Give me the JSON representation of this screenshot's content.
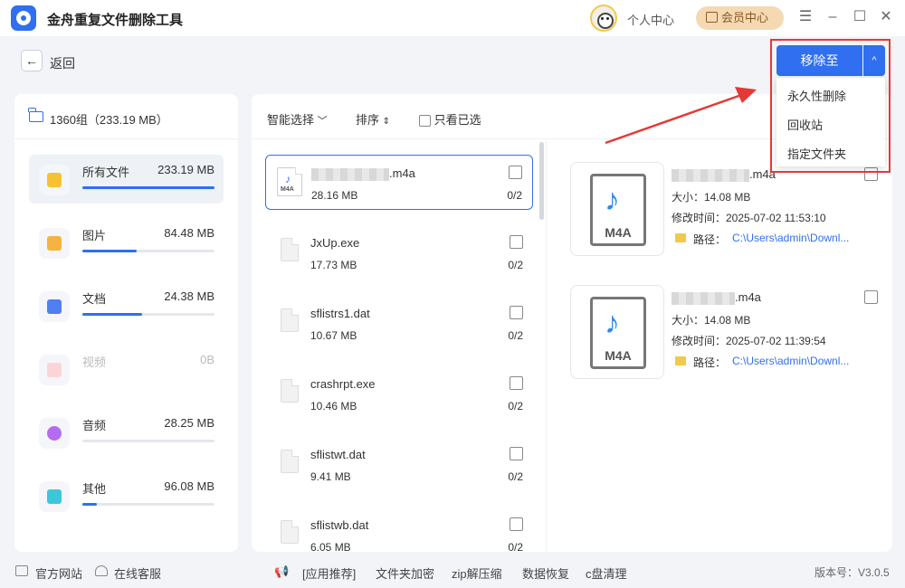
{
  "app": {
    "title": "金舟重复文件删除工具"
  },
  "header": {
    "user_center": "个人中心",
    "vip_center": "会员中心"
  },
  "nav": {
    "back_label": "返回"
  },
  "move_menu": {
    "button_label": "移除至",
    "caret": "^",
    "items": [
      "永久性删除",
      "回收站",
      "指定文件夹"
    ]
  },
  "sidebar": {
    "group_label": "1360组（233.19 MB）",
    "categories": [
      {
        "name": "所有文件",
        "size": "233.19 MB",
        "progress": 1.0
      },
      {
        "name": "图片",
        "size": "84.48 MB",
        "progress": 0.41
      },
      {
        "name": "文档",
        "size": "24.38 MB",
        "progress": 0.45
      },
      {
        "name": "视频",
        "size": "0B",
        "progress": 0
      },
      {
        "name": "音频",
        "size": "28.25 MB",
        "progress": 0.0
      },
      {
        "name": "其他",
        "size": "96.08 MB",
        "progress": 0.11
      }
    ]
  },
  "toolbar": {
    "smart_select": "智能选择",
    "sort": "排序",
    "only_checked": "只看已选"
  },
  "files": [
    {
      "name": ".m4a",
      "size": "28.16 MB",
      "count": "0/2"
    },
    {
      "name": "JxUp.exe",
      "size": "17.73 MB",
      "count": "0/2"
    },
    {
      "name": "sflistrs1.dat",
      "size": "10.67 MB",
      "count": "0/2"
    },
    {
      "name": "crashrpt.exe",
      "size": "10.46 MB",
      "count": "0/2"
    },
    {
      "name": "sflistwt.dat",
      "size": "9.41 MB",
      "count": "0/2"
    },
    {
      "name": "sflistwb.dat",
      "size": "6.05 MB",
      "count": "0/2"
    }
  ],
  "details": [
    {
      "name": ".m4a",
      "size": "大小：14.08 MB",
      "mtime": "修改时间：2025-07-02 11:53:10",
      "path_label": "路径：",
      "path": "C:\\Users\\admin\\Downl...",
      "thumb_label": "M4A"
    },
    {
      "name": ".m4a",
      "size": "大小：14.08 MB",
      "mtime": "修改时间：2025-07-02 11:39:54",
      "path_label": "路径：",
      "path": "C:\\Users\\admin\\Downl...",
      "thumb_label": "M4A"
    }
  ],
  "footer": {
    "official_site": "官方网站",
    "online_service": "在线客服",
    "app_recommend": "[应用推荐]",
    "links": [
      "文件夹加密",
      "zip解压缩",
      "数据恢复",
      "c盘清理"
    ],
    "version": "版本号：V3.0.5"
  },
  "colors": {
    "accent": "#2f6ff0",
    "annotation": "#e53935",
    "vip": "#f4d9b3"
  }
}
